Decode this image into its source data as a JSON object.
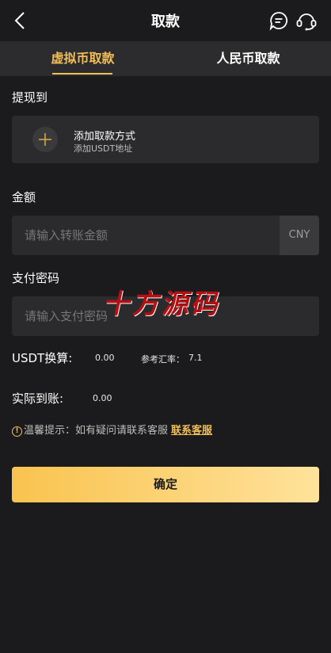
{
  "header": {
    "title": "取款"
  },
  "tabs": [
    {
      "label": "虚拟币取款",
      "active": true
    },
    {
      "label": "人民币取款",
      "active": false
    }
  ],
  "withdraw_to": {
    "label": "提现到",
    "add_title": "添加取款方式",
    "add_subtitle": "添加USDT地址"
  },
  "amount": {
    "label": "金额",
    "placeholder": "请输入转账金额",
    "currency": "CNY"
  },
  "password": {
    "label": "支付密码",
    "placeholder": "请输入支付密码"
  },
  "watermark": "十方源码",
  "conversion": {
    "label": "USDT换算:",
    "value": "0.00",
    "rate_label": "参考汇率：",
    "rate_value": "7.1"
  },
  "actual": {
    "label": "实际到账:",
    "value": "0.00"
  },
  "tip": {
    "icon": "!",
    "text": "温馨提示：如有疑问请联系客服",
    "link": "联系客服"
  },
  "confirm_label": "确定",
  "colors": {
    "accent": "#f3bd57",
    "background": "#1b1b1d",
    "panel": "#2b2b2d",
    "watermark": "#b40f12"
  },
  "icons": [
    "back-arrow-icon",
    "chat-bubble-icon",
    "headset-icon",
    "plus-icon",
    "info-icon"
  ]
}
